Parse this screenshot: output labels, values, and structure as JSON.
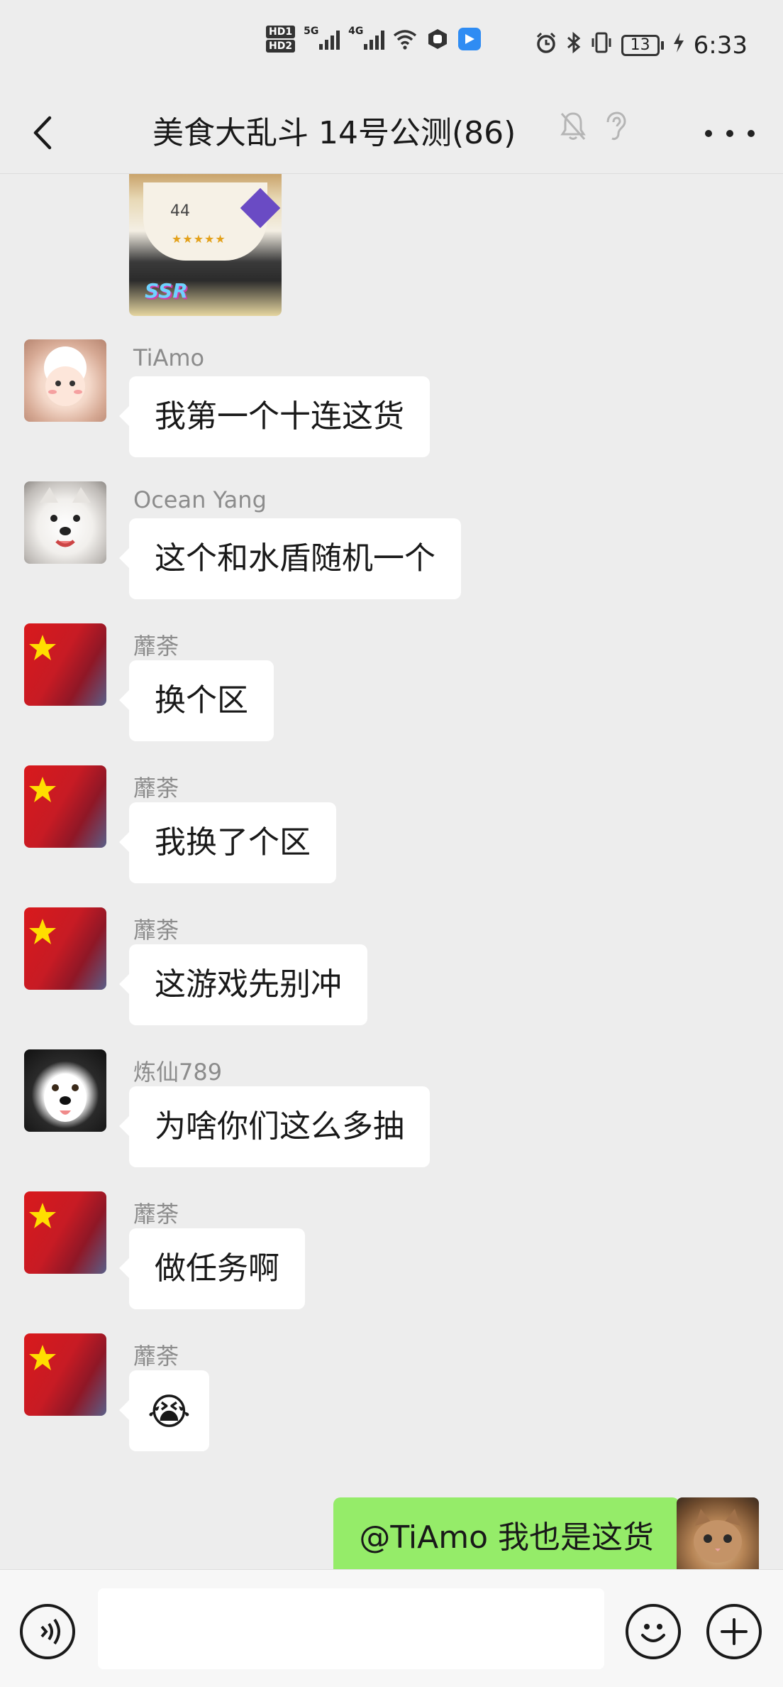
{
  "status_bar": {
    "hd1": "HD1",
    "hd2": "HD2",
    "signal1_label": "5G",
    "signal2_label": "4G",
    "battery": "13",
    "time": "6:33",
    "icons": [
      "wifi-icon",
      "hand-icon",
      "app-badge-icon",
      "alarm-icon",
      "bluetooth-icon",
      "vibrate-icon",
      "charging-icon"
    ]
  },
  "header": {
    "title": "美食大乱斗 14号公测(86)",
    "icons": [
      "back-icon",
      "mute-icon",
      "earpiece-icon",
      "more-icon"
    ]
  },
  "shared_image": {
    "level": "44",
    "stars": "★★★★★",
    "rarity": "SSR"
  },
  "messages": [
    {
      "sender": "TiAmo",
      "text": "我第一个十连这货",
      "avatar": "sheep"
    },
    {
      "sender": "Ocean Yang",
      "text": "这个和水盾随机一个",
      "avatar": "dog"
    },
    {
      "sender": "蘼荼",
      "text": "换个区",
      "avatar": "flag"
    },
    {
      "sender": "蘼荼",
      "text": "我换了个区",
      "avatar": "flag"
    },
    {
      "sender": "蘼荼",
      "text": "这游戏先别冲",
      "avatar": "flag"
    },
    {
      "sender": "炼仙789",
      "text": "为啥你们这么多抽",
      "avatar": "husky"
    },
    {
      "sender": "蘼荼",
      "text": "做任务啊",
      "avatar": "flag"
    },
    {
      "sender": "蘼荼",
      "text": "😭",
      "avatar": "flag"
    }
  ],
  "my_message": {
    "text": "@TiAmo  我也是这货",
    "avatar": "cat"
  },
  "input_bar": {
    "placeholder": "",
    "icons": [
      "voice-icon",
      "emoji-icon",
      "plus-icon"
    ]
  },
  "colors": {
    "background": "#ededed",
    "bubble_other": "#ffffff",
    "bubble_mine": "#95ec69",
    "sender_name": "#8c8c8c"
  }
}
